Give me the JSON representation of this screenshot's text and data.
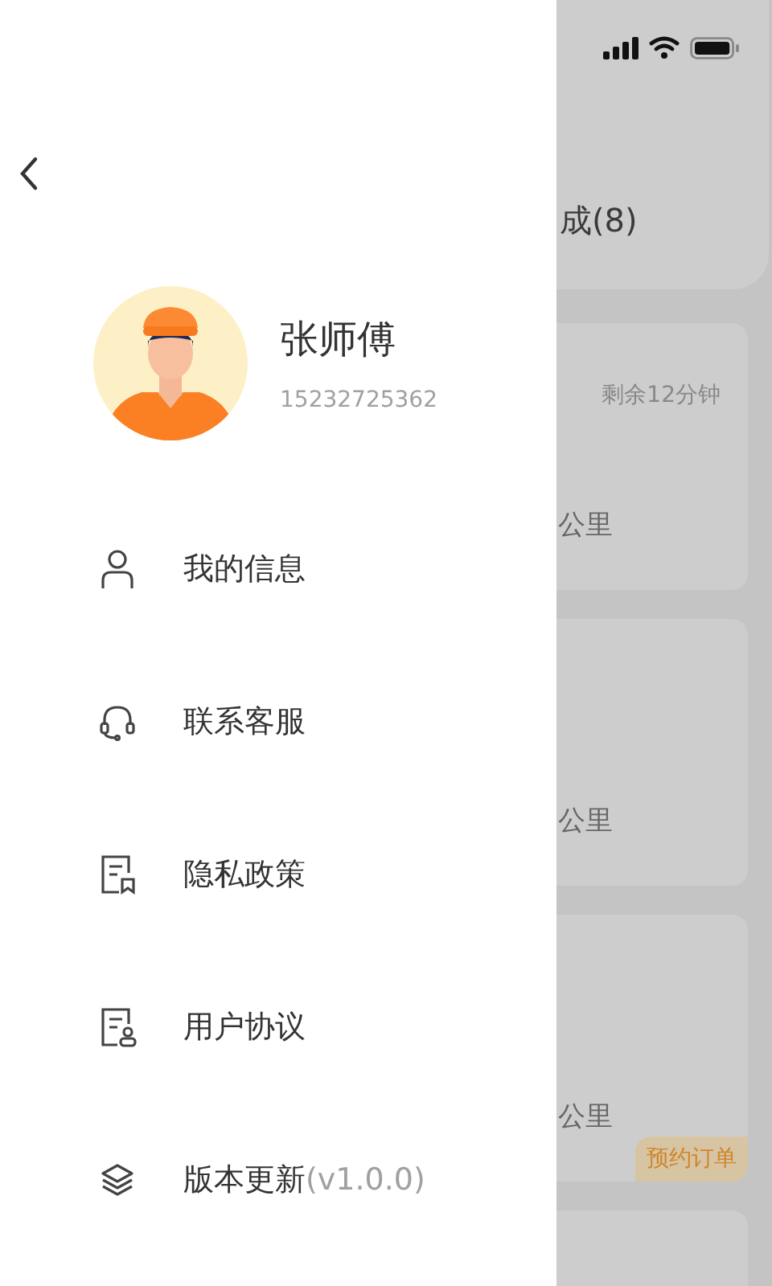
{
  "drawer": {
    "profile": {
      "name": "张师傅",
      "phone": "15232725362"
    },
    "menu": [
      {
        "kind": "user",
        "label": "我的信息"
      },
      {
        "kind": "headset",
        "label": "联系客服"
      },
      {
        "kind": "privacy",
        "label": "隐私政策"
      },
      {
        "kind": "agreement",
        "label": "用户协议"
      },
      {
        "kind": "layers",
        "label": "版本更新",
        "note": "(v1.0.0)"
      }
    ]
  },
  "background": {
    "header_tab": "成(8)",
    "cards": [
      {
        "kind": "order",
        "time_left": "剩余12分钟",
        "distance": "公里"
      },
      {
        "kind": "order",
        "distance": "公里"
      },
      {
        "kind": "order",
        "distance": "公里",
        "tag": "预约订单"
      },
      {
        "kind": "order"
      }
    ]
  }
}
